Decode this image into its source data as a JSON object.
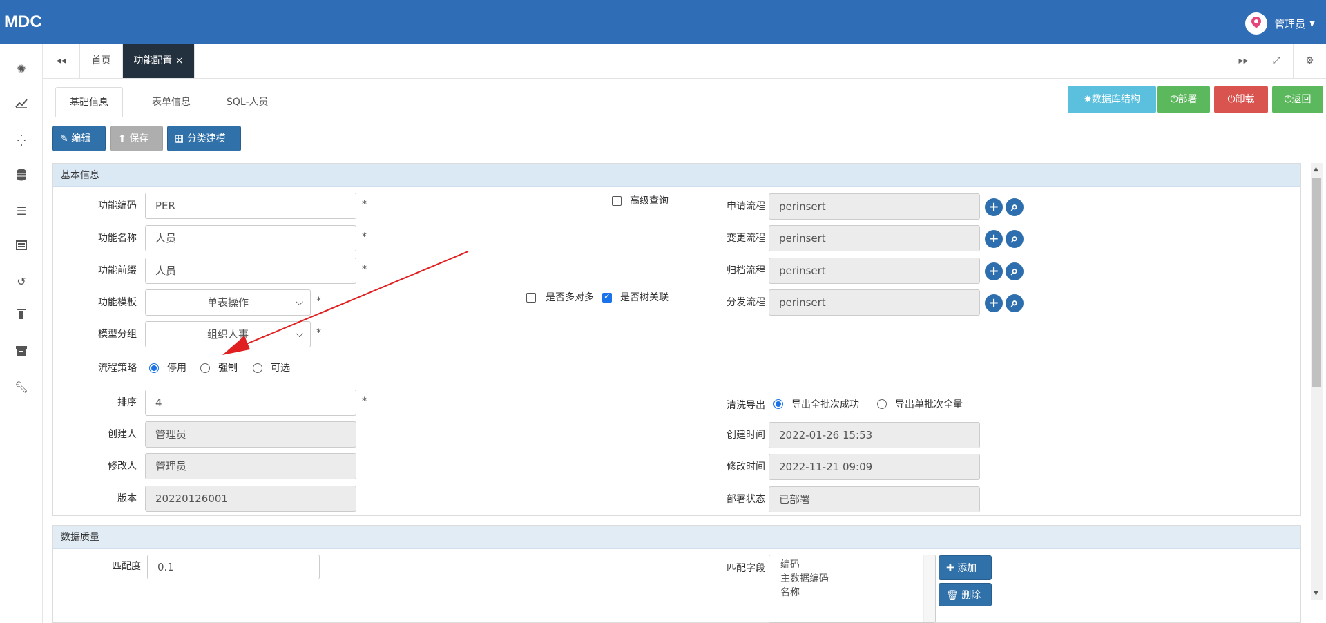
{
  "app": {
    "logo": "MDC",
    "user_name": "管理员"
  },
  "sidebar": {
    "icons": [
      "settings-icon",
      "chart-line-icon",
      "spinner-icon",
      "database-icon",
      "list-icon",
      "server-icon",
      "history-icon",
      "film-icon",
      "archive-icon",
      "wrench-icon"
    ]
  },
  "tabstrip": {
    "back": "◂◂",
    "home": "首页",
    "active_tab": "功能配置",
    "close": "×",
    "forward": "▸▸",
    "fullscreen": "⤢",
    "gear": "⚙"
  },
  "subtabs": {
    "basic": "基础信息",
    "form": "表单信息",
    "sql": "SQL-人员"
  },
  "top_buttons": {
    "db_structure": "数据库结构",
    "deploy": "部署",
    "undeploy": "卸载",
    "back": "返回",
    "colors": {
      "info": "#5bc0de",
      "success": "#5cb85c",
      "danger": "#d9534f"
    }
  },
  "toolbar": {
    "edit": "编辑",
    "save": "保存",
    "category": "分类建模"
  },
  "basic_panel": {
    "title": "基本信息",
    "func_code_label": "功能编码",
    "func_code": "PER",
    "func_name_label": "功能名称",
    "func_name": "人员",
    "func_prefix_label": "功能前缀",
    "func_prefix": "人员",
    "func_template_label": "功能模板",
    "func_template": "单表操作",
    "model_group_label": "模型分组",
    "model_group": "组织人事",
    "flow_strategy_label": "流程策略",
    "flow_options": [
      "停用",
      "强制",
      "可选"
    ],
    "sort_label": "排序",
    "sort": "4",
    "creator_label": "创建人",
    "creator": "管理员",
    "modifier_label": "修改人",
    "modifier": "管理员",
    "version_label": "版本",
    "version": "20220126001",
    "advanced_query": "高级查询",
    "many_to_many": "是否多对多",
    "tree_relation": "是否树关联",
    "apply_flow_label": "申请流程",
    "apply_flow": "perinsert",
    "change_flow_label": "变更流程",
    "change_flow": "perinsert",
    "archive_flow_label": "归档流程",
    "archive_flow": "perinsert",
    "dispatch_flow_label": "分发流程",
    "dispatch_flow": "perinsert",
    "clean_export_label": "清洗导出",
    "clean_options": [
      "导出全批次成功",
      "导出单批次全量"
    ],
    "create_time_label": "创建时间",
    "create_time": "2022-01-26 15:53",
    "modify_time_label": "修改时间",
    "modify_time": "2022-11-21 09:09",
    "deploy_status_label": "部署状态",
    "deploy_status": "已部署",
    "required_mark": "*"
  },
  "quality_panel": {
    "title": "数据质量",
    "match_label": "匹配度",
    "match": "0.1",
    "match_fields_label": "匹配字段",
    "match_fields": [
      "编码",
      "主数据编码",
      "名称"
    ],
    "add": "添加",
    "delete": "删除"
  }
}
